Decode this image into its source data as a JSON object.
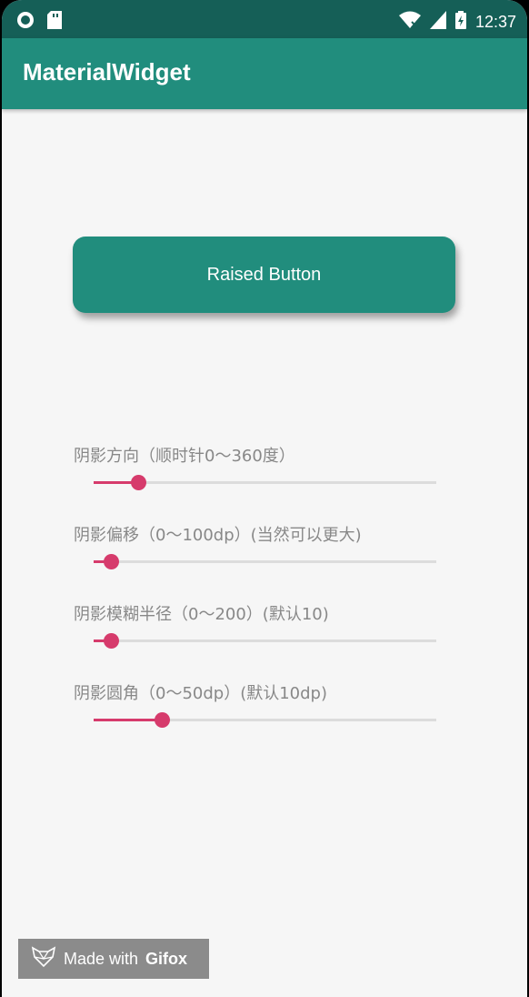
{
  "status_bar": {
    "time": "12:37"
  },
  "app_bar": {
    "title": "MaterialWidget"
  },
  "raised_button": {
    "label": "Raised Button"
  },
  "sliders": [
    {
      "label": "阴影方向（顺时针0～360度）",
      "value": 0.13
    },
    {
      "label": "阴影偏移（0～100dp）(当然可以更大)",
      "value": 0.05
    },
    {
      "label": "阴影模糊半径（0～200）(默认10)",
      "value": 0.05
    },
    {
      "label": "阴影圆角（0～50dp）(默认10dp)",
      "value": 0.2
    }
  ],
  "watermark": {
    "prefix": "Made with",
    "brand": "Gifox"
  },
  "colors": {
    "primary": "#218d7d",
    "primary_dark": "#155f57",
    "accent": "#d63b6c"
  }
}
